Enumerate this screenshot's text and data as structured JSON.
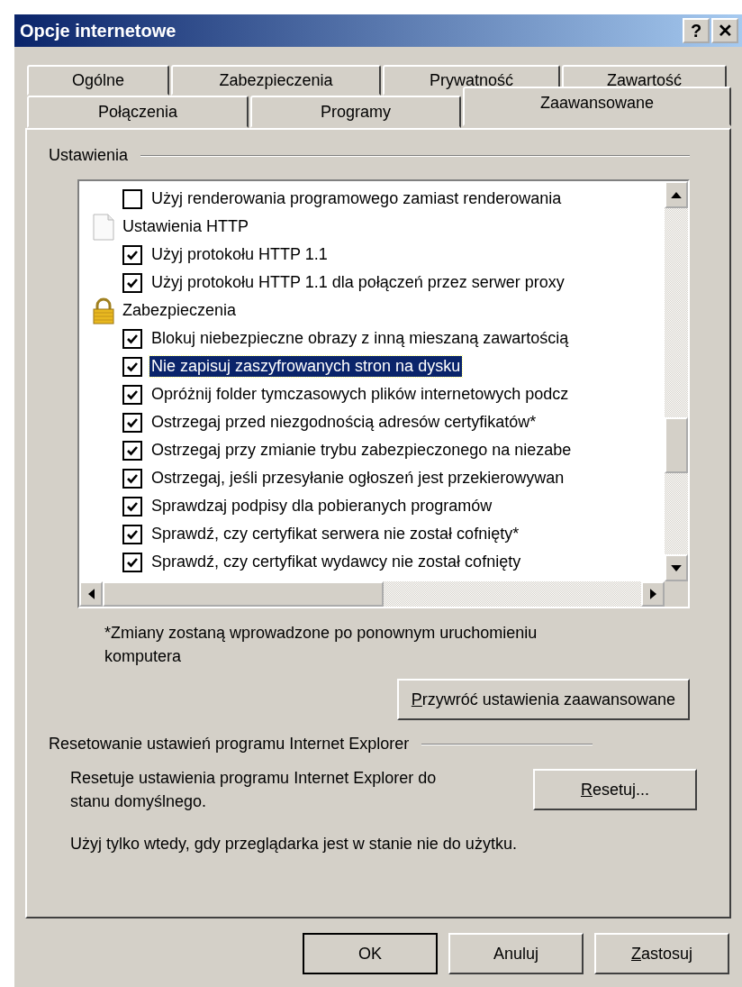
{
  "window": {
    "title": "Opcje internetowe",
    "help": "?",
    "close": "✕"
  },
  "tab_rows": [
    [
      {
        "label": "Ogólne",
        "selected": false
      },
      {
        "label": "Zabezpieczenia",
        "selected": false
      },
      {
        "label": "Prywatność",
        "selected": false
      },
      {
        "label": "Zawartość",
        "selected": false
      }
    ],
    [
      {
        "label": "Połączenia",
        "selected": false
      },
      {
        "label": "Programy",
        "selected": false
      },
      {
        "label": "Zaawansowane",
        "selected": true
      }
    ]
  ],
  "settings": {
    "title": "Ustawienia",
    "items": [
      {
        "kind": "checkbox",
        "label": "Użyj renderowania programowego zamiast renderowania",
        "checked": false,
        "selected": false
      },
      {
        "kind": "pageheading",
        "label": "Ustawienia HTTP"
      },
      {
        "kind": "checkbox",
        "label": "Użyj protokołu HTTP 1.1",
        "checked": true,
        "selected": false
      },
      {
        "kind": "checkbox",
        "label": "Użyj protokołu HTTP 1.1 dla połączeń przez serwer proxy",
        "checked": true,
        "selected": false
      },
      {
        "kind": "lockheading",
        "label": "Zabezpieczenia"
      },
      {
        "kind": "checkbox",
        "label": "Blokuj niebezpieczne obrazy z inną mieszaną zawartością",
        "checked": true,
        "selected": false
      },
      {
        "kind": "checkbox",
        "label": "Nie zapisuj zaszyfrowanych stron na dysku",
        "checked": true,
        "selected": true
      },
      {
        "kind": "checkbox",
        "label": "Opróżnij folder tymczasowych plików internetowych podcz",
        "checked": true,
        "selected": false
      },
      {
        "kind": "checkbox",
        "label": "Ostrzegaj przed niezgodnością adresów certyfikatów*",
        "checked": true,
        "selected": false
      },
      {
        "kind": "checkbox",
        "label": "Ostrzegaj przy zmianie trybu zabezpieczonego na niezabe",
        "checked": true,
        "selected": false
      },
      {
        "kind": "checkbox",
        "label": "Ostrzegaj, jeśli przesyłanie ogłoszeń jest przekierowywan",
        "checked": true,
        "selected": false
      },
      {
        "kind": "checkbox",
        "label": "Sprawdzaj podpisy dla pobieranych programów",
        "checked": true,
        "selected": false
      },
      {
        "kind": "checkbox",
        "label": "Sprawdź, czy certyfikat serwera nie został cofnięty*",
        "checked": true,
        "selected": false
      },
      {
        "kind": "checkbox",
        "label": "Sprawdź, czy certyfikat wydawcy nie został cofnięty",
        "checked": true,
        "selected": false
      }
    ],
    "note": "*Zmiany zostaną wprowadzone po ponownym uruchomieniu komputera",
    "restore_button": {
      "label": "Przywróć ustawienia zaawansowane",
      "access_key_underlined": true
    }
  },
  "reset": {
    "title": "Resetowanie ustawień programu Internet Explorer",
    "description": "Resetuje ustawienia programu Internet Explorer do stanu domyślnego.",
    "button": {
      "label": "Resetuj...",
      "access_key_underlined": true
    },
    "hint": "Użyj tylko wtedy, gdy przeglądarka jest w stanie nie do użytku."
  },
  "buttons": [
    {
      "label": "OK",
      "default": true,
      "access_key_underlined": false
    },
    {
      "label": "Anuluj",
      "default": false,
      "access_key_underlined": false
    },
    {
      "label": "Zastosuj",
      "default": false,
      "access_key_underlined": true
    }
  ]
}
